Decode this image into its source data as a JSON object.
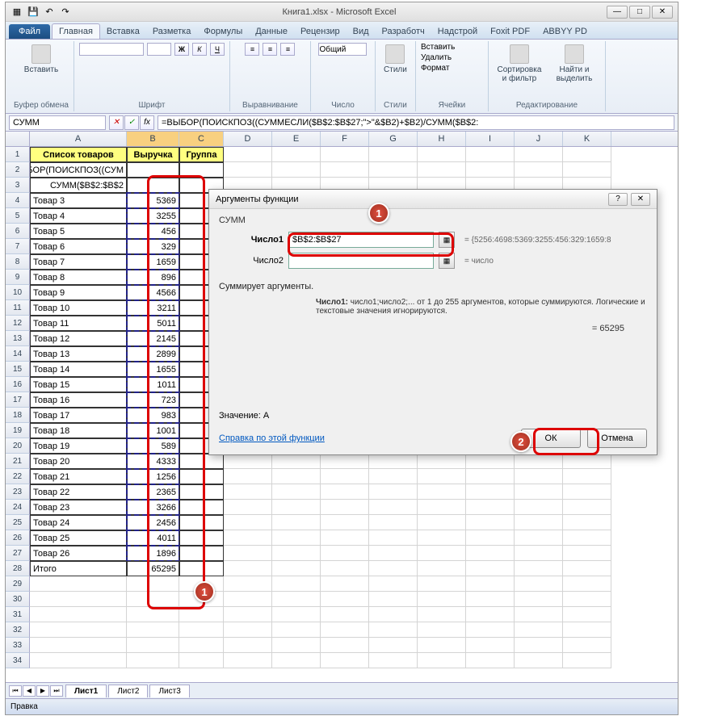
{
  "window": {
    "title": "Книга1.xlsx - Microsoft Excel"
  },
  "ribbon": {
    "file": "Файл",
    "tabs": [
      "Главная",
      "Вставка",
      "Разметка",
      "Формулы",
      "Данные",
      "Рецензир",
      "Вид",
      "Разработч",
      "Надстрой",
      "Foxit PDF",
      "ABBYY PD"
    ],
    "groups": {
      "clipboard": {
        "label": "Буфер обмена",
        "paste": "Вставить"
      },
      "font": {
        "label": "Шрифт"
      },
      "alignment": {
        "label": "Выравнивание"
      },
      "number": {
        "label": "Число",
        "format": "Общий"
      },
      "styles": {
        "label": "Стили",
        "btn": "Стили"
      },
      "cells": {
        "label": "Ячейки",
        "insert": "Вставить",
        "delete": "Удалить",
        "format": "Формат"
      },
      "editing": {
        "label": "Редактирование",
        "sort": "Сортировка и фильтр",
        "find": "Найти и выделить"
      }
    }
  },
  "namebox": "СУММ",
  "formula": "=ВЫБОР(ПОИСКПОЗ((СУММЕСЛИ($B$2:$B$27;\">\"&$B2)+$B2)/СУММ($B$2:",
  "columns": [
    "A",
    "B",
    "C",
    "D",
    "E",
    "F",
    "G",
    "H",
    "I",
    "J",
    "K"
  ],
  "headers": {
    "a": "Список товаров",
    "b": "Выручка",
    "c": "Группа"
  },
  "row2a": "=ВЫБОР(ПОИСКПОЗ((СУМ",
  "row3a": "СУММ($B$2:$B$2",
  "table": [
    {
      "r": 4,
      "name": "Товар 3",
      "val": "5369"
    },
    {
      "r": 5,
      "name": "Товар 4",
      "val": "3255"
    },
    {
      "r": 6,
      "name": "Товар 5",
      "val": "456"
    },
    {
      "r": 7,
      "name": "Товар 6",
      "val": "329"
    },
    {
      "r": 8,
      "name": "Товар 7",
      "val": "1659"
    },
    {
      "r": 9,
      "name": "Товар 8",
      "val": "896"
    },
    {
      "r": 10,
      "name": "Товар 9",
      "val": "4566"
    },
    {
      "r": 11,
      "name": "Товар 10",
      "val": "3211"
    },
    {
      "r": 12,
      "name": "Товар 11",
      "val": "5011"
    },
    {
      "r": 13,
      "name": "Товар 12",
      "val": "2145"
    },
    {
      "r": 14,
      "name": "Товар 13",
      "val": "2899"
    },
    {
      "r": 15,
      "name": "Товар 14",
      "val": "1655"
    },
    {
      "r": 16,
      "name": "Товар 15",
      "val": "1011"
    },
    {
      "r": 17,
      "name": "Товар 16",
      "val": "723"
    },
    {
      "r": 18,
      "name": "Товар 17",
      "val": "983"
    },
    {
      "r": 19,
      "name": "Товар 18",
      "val": "1001"
    },
    {
      "r": 20,
      "name": "Товар 19",
      "val": "589"
    },
    {
      "r": 21,
      "name": "Товар 20",
      "val": "4333"
    },
    {
      "r": 22,
      "name": "Товар 21",
      "val": "1256"
    },
    {
      "r": 23,
      "name": "Товар 22",
      "val": "2365"
    },
    {
      "r": 24,
      "name": "Товар 23",
      "val": "3266"
    },
    {
      "r": 25,
      "name": "Товар 24",
      "val": "2456"
    },
    {
      "r": 26,
      "name": "Товар 25",
      "val": "4011"
    },
    {
      "r": 27,
      "name": "Товар 26",
      "val": "1896"
    }
  ],
  "total_row": {
    "label": "Итого",
    "val": "65295"
  },
  "dialog": {
    "title": "Аргументы функции",
    "func": "СУММ",
    "arg1_label": "Число1",
    "arg1_value": "$B$2:$B$27",
    "arg1_result": "= {5256:4698:5369:3255:456:329:1659:8",
    "arg2_label": "Число2",
    "arg2_result": "= число",
    "result": "= 65295",
    "desc": "Суммирует аргументы.",
    "arg_desc_label": "Число1:",
    "arg_desc": "число1;число2;... от 1 до 255 аргументов, которые суммируются. Логические и текстовые значения игнорируются.",
    "value_label": "Значение:",
    "value": "A",
    "help": "Справка по этой функции",
    "ok": "ОК",
    "cancel": "Отмена"
  },
  "sheets": [
    "Лист1",
    "Лист2",
    "Лист3"
  ],
  "status": "Правка",
  "badges": {
    "b1": "1",
    "b2": "2"
  }
}
